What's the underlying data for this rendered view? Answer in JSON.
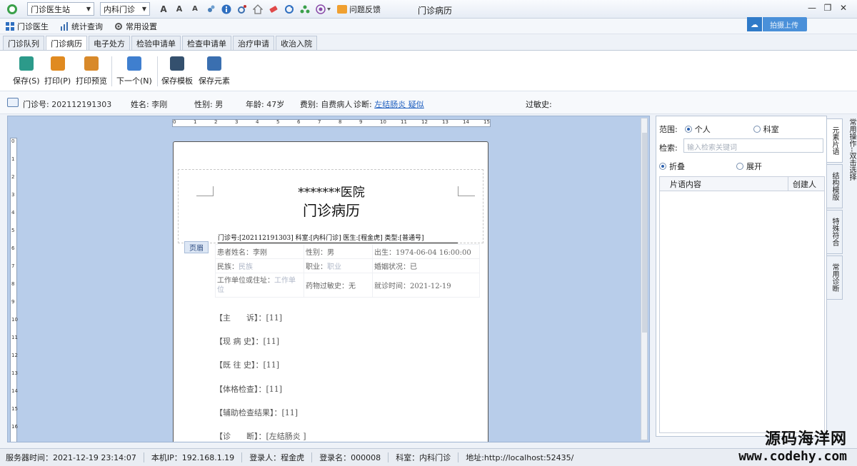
{
  "titlebar": {
    "station_combo": "门诊医生站",
    "dept_combo": "内科门诊",
    "feedback_label": "问题反馈",
    "window_title": "门诊病历",
    "icons": [
      "font-increase-icon",
      "font-normal-icon",
      "font-decrease-icon",
      "tool-icon",
      "info-icon",
      "settings-icon",
      "home-icon",
      "eraser-icon",
      "refresh-icon",
      "network-icon",
      "theme-icon"
    ],
    "font_glyphs": {
      "increase": "A",
      "normal": "A",
      "decrease": "A"
    }
  },
  "navbar": {
    "items": [
      {
        "label": "门诊医生"
      },
      {
        "label": "统计查询"
      },
      {
        "label": "常用设置"
      }
    ],
    "upload_label": "拍摄上传"
  },
  "tabs": [
    "门诊队列",
    "门诊病历",
    "电子处方",
    "检验申请单",
    "检查申请单",
    "治疗申请",
    "收治入院"
  ],
  "active_tab": "门诊病历",
  "ribbon": {
    "buttons": [
      {
        "label": "保存(S)",
        "color": "#2c9a8a"
      },
      {
        "label": "打印(P)",
        "color": "#e08a20"
      },
      {
        "label": "打印预览",
        "color": "#d8892a"
      },
      {
        "label": "下一个(N)",
        "color": "#3f7fcf"
      },
      {
        "label": "保存模板",
        "color": "#34506e"
      },
      {
        "label": "保存元素",
        "color": "#3a6fb0"
      }
    ]
  },
  "patient": {
    "visit_no_label": "门诊号:",
    "visit_no": "202112191303",
    "name_label": "姓名:",
    "name": "李刚",
    "gender_label": "性别:",
    "gender": "男",
    "age_label": "年龄:",
    "age": "47岁",
    "fee_label": "费别:",
    "fee": "自费病人",
    "diag_label": "诊断:",
    "diagnosis": "左结肠炎 疑似",
    "allergy_label": "过敏史:",
    "allergy": ""
  },
  "ruler": {
    "top": [
      "0",
      "1",
      "2",
      "3",
      "4",
      "5",
      "6",
      "7",
      "8",
      "9",
      "10",
      "11",
      "12",
      "13",
      "14",
      "15"
    ],
    "left": [
      "0",
      "1",
      "2",
      "3",
      "4",
      "5",
      "6",
      "7",
      "8",
      "9",
      "10",
      "11",
      "12",
      "13",
      "14",
      "15",
      "16"
    ]
  },
  "document": {
    "hospital": "*******医院",
    "record_title": "门诊病历",
    "visit_line": "门诊号:[202112191303] 科室:[内科门诊] 医生:[程金虎] 类型:[普通号]",
    "page_tag": "页眉",
    "rows": [
      [
        "患者姓名：李刚",
        "性别：男",
        "出生：1974-06-04 16:00:00"
      ],
      [
        "民族：",
        "民族",
        "职业：",
        "职业",
        "婚姻状况：已"
      ],
      [
        "工作单位或住址：",
        "工作单位",
        "药物过敏史：无",
        "就诊时间：2021-12-19"
      ]
    ],
    "sections": [
      "【主　　诉】：[11]",
      "【现 病 史】：[11]",
      "【既 往 史】：[11]",
      "【体格检查】：[11]",
      "【辅助检查结果】：[11]",
      "【诊　　断】：[左结肠炎 ]"
    ]
  },
  "right_panel": {
    "scope_label": "范围:",
    "scope_personal": "个人",
    "scope_dept": "科室",
    "search_label": "检索:",
    "search_placeholder": "输入检索关键词",
    "fold_label": "折叠",
    "expand_label": "展开",
    "col_content": "片语内容",
    "col_creator": "创建人",
    "vertical_tabs": [
      "元素片语",
      "结构模版",
      "特殊符合",
      "常用诊断"
    ],
    "far_tab": "常用操作--双击选择"
  },
  "statusbar": {
    "server_time": "服务器时间：2021-12-19 23:14:07",
    "local_ip": "本机IP：192.168.1.19",
    "login_user": "登录人：程金虎",
    "login_name": "登录名：000008",
    "dept": "科室：内科门诊",
    "address": "地址:http://localhost:52435/"
  },
  "watermark": {
    "line1": "源码海洋网",
    "line2": "www.codehy.com"
  }
}
